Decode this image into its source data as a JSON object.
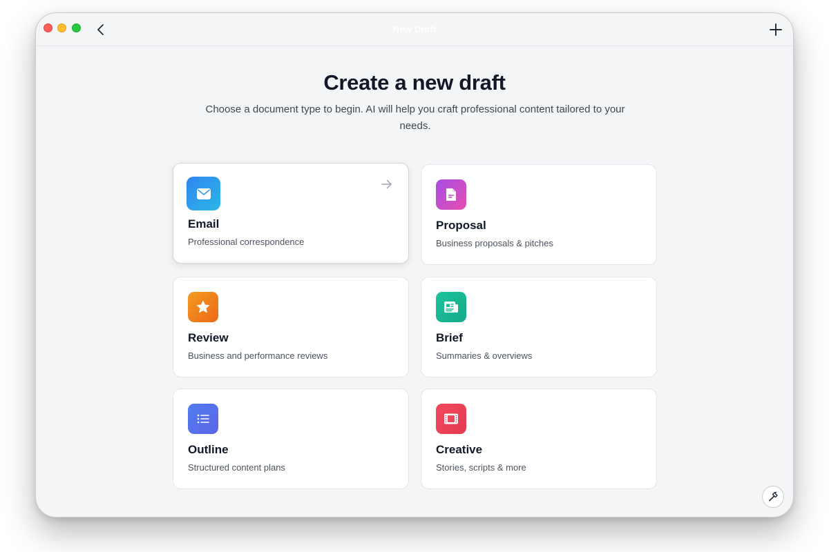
{
  "window": {
    "title": "New Draft"
  },
  "header": {
    "title": "Create a new draft",
    "subtitle": "Choose a document type to begin. AI will help you craft professional content tailored to your needs."
  },
  "cards": [
    {
      "title": "Email",
      "description": "Professional correspondence",
      "icon": "envelope-icon",
      "color_from": "#2f86f0",
      "color_to": "#2bb6e6",
      "selected": true
    },
    {
      "title": "Proposal",
      "description": "Business proposals & pitches",
      "icon": "document-icon",
      "color_from": "#a64ee6",
      "color_to": "#e64fae",
      "selected": false
    },
    {
      "title": "Review",
      "description": "Business and performance reviews",
      "icon": "star-icon",
      "color_from": "#f08a1c",
      "color_to": "#ec6a14",
      "selected": false
    },
    {
      "title": "Brief",
      "description": "Summaries & overviews",
      "icon": "newspaper-icon",
      "color_from": "#1cc49a",
      "color_to": "#14a98a",
      "selected": false
    },
    {
      "title": "Outline",
      "description": "Structured content plans",
      "icon": "list-icon",
      "color_from": "#4f7df0",
      "color_to": "#5d65e8",
      "selected": false
    },
    {
      "title": "Creative",
      "description": "Stories, scripts & more",
      "icon": "film-icon",
      "color_from": "#f04a5e",
      "color_to": "#e43a50",
      "selected": false
    }
  ],
  "colors": {
    "background": "#f4f5f7",
    "card": "#ffffff",
    "text_primary": "#111827",
    "text_secondary": "#4b5260"
  }
}
